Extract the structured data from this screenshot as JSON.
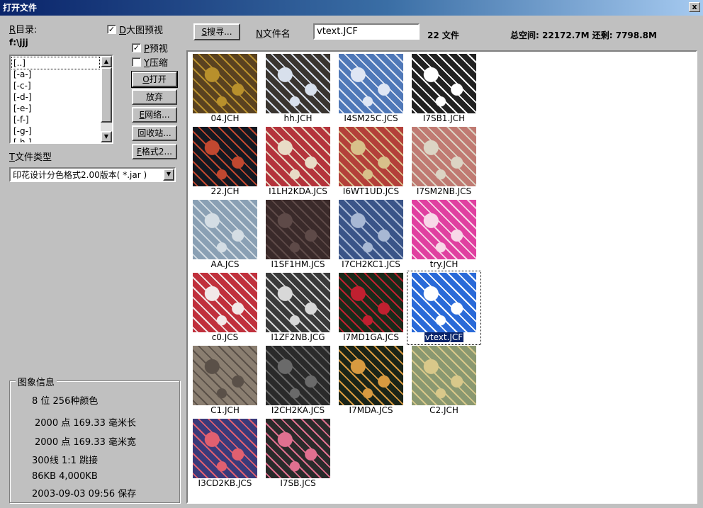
{
  "window": {
    "title": "打开文件",
    "close_glyph": "x"
  },
  "left": {
    "dir_label_key": "R",
    "dir_label_text": "目录:",
    "current_path": "f:\\jjj",
    "large_preview": {
      "key": "D",
      "text": "大图预视",
      "checked": true
    },
    "preview": {
      "key": "P",
      "text": "预视",
      "checked": true
    },
    "compress": {
      "key": "Y",
      "text": "压缩",
      "checked": false
    },
    "check_glyph": "✓",
    "dirs": [
      "[..]",
      "[-a-]",
      "[-c-]",
      "[-d-]",
      "[-e-]",
      "[-f-]",
      "[-g-]",
      "[-h-]"
    ],
    "scroll_up": "▲",
    "scroll_down": "▼",
    "buttons": {
      "open_key": "O",
      "open_text": "打开",
      "cancel": "放弃",
      "network_key": "E",
      "network_text": "网络...",
      "recycle": "回收站...",
      "format_key": "F",
      "format_text": "格式2..."
    },
    "type_label_key": "T",
    "type_label_text": "文件类型",
    "type_value": "印花设计分色格式2.00版本( *.jar )",
    "type_drop": "▼"
  },
  "info": {
    "legend": "图象信息",
    "line1": "8 位  256种颜色",
    "line2": "2000 点   169.33 毫米长",
    "line3": "2000 点   169.33 毫米宽",
    "line4": "300线  1:1 跳接",
    "line5": "86KB   4,000KB",
    "line6": "2003-09-03  09:56  保存"
  },
  "toolbar": {
    "search_key": "S",
    "search_text": "搜寻...",
    "filename_key": "N",
    "filename_text": "文件名",
    "filename_value": "vtext.JCF",
    "count": "22 文件",
    "space": "总空间: 22172.7M  还剩: 7798.8M"
  },
  "files": [
    {
      "name": "04.JCH",
      "colors": [
        "#5a4220",
        "#b8902c"
      ]
    },
    {
      "name": "hh.JCH",
      "colors": [
        "#3a3530",
        "#d8e0ec"
      ]
    },
    {
      "name": "I4SM25C.JCS",
      "colors": [
        "#4f78b8",
        "#dfe6f4"
      ]
    },
    {
      "name": "I7SB1.JCH",
      "colors": [
        "#222222",
        "#ffffff"
      ]
    },
    {
      "name": "22.JCH",
      "colors": [
        "#141820",
        "#c04830"
      ]
    },
    {
      "name": "I1LH2KDA.JCS",
      "colors": [
        "#b4343c",
        "#e8dcc6"
      ]
    },
    {
      "name": "I6WT1UD.JCS",
      "colors": [
        "#b4403a",
        "#d8c08a"
      ]
    },
    {
      "name": "I7SM2NB.JCS",
      "colors": [
        "#c07a72",
        "#dcd4c4"
      ]
    },
    {
      "name": "AA.JCS",
      "colors": [
        "#8aa0b4",
        "#d4dde4"
      ]
    },
    {
      "name": "I1SF1HM.JCS",
      "colors": [
        "#3a2a2a",
        "#5e4a48"
      ]
    },
    {
      "name": "I7CH2KC1.JCS",
      "colors": [
        "#3a5488",
        "#a8b8d4"
      ]
    },
    {
      "name": "try.JCH",
      "colors": [
        "#e040a0",
        "#f8d8e8"
      ]
    },
    {
      "name": "c0.JCS",
      "colors": [
        "#c0303c",
        "#f2e8e8"
      ]
    },
    {
      "name": "I1ZF2NB.JCG",
      "colors": [
        "#3a3a3a",
        "#d8d8d8"
      ]
    },
    {
      "name": "I7MD1GA.JCS",
      "colors": [
        "#1a2a1a",
        "#c02030"
      ]
    },
    {
      "name": "vtext.JCF",
      "colors": [
        "#2a6ad8",
        "#ffffff"
      ]
    },
    {
      "name": "C1.JCH",
      "colors": [
        "#8a7e70",
        "#5a5048"
      ]
    },
    {
      "name": "I2CH2KA.JCS",
      "colors": [
        "#2a2a2a",
        "#6a6a6a"
      ]
    },
    {
      "name": "I7MDA.JCS",
      "colors": [
        "#1a2418",
        "#d89a40"
      ]
    },
    {
      "name": "C2.JCH",
      "colors": [
        "#8a9870",
        "#d8c88a"
      ]
    },
    {
      "name": "I3CD2KB.JCS",
      "colors": [
        "#3a3a7a",
        "#e06070"
      ]
    },
    {
      "name": "I7SB.JCS",
      "colors": [
        "#2a2a2a",
        "#e07090"
      ]
    }
  ]
}
